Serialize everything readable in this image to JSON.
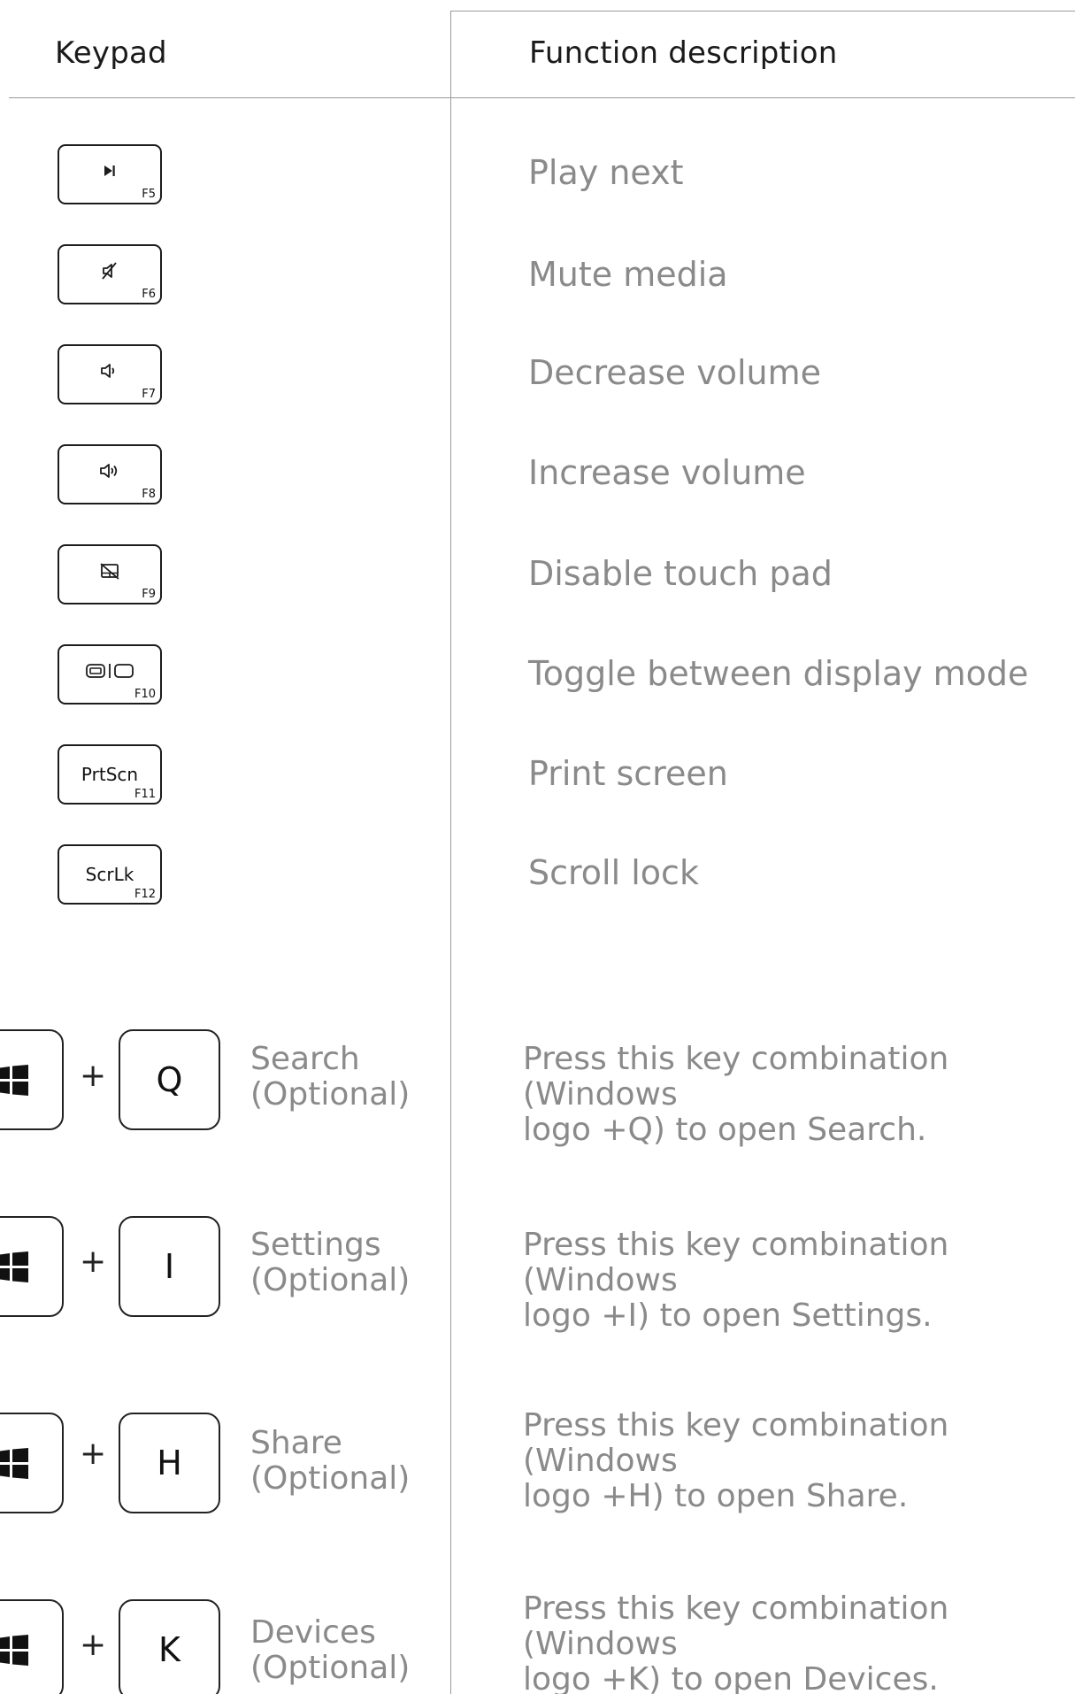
{
  "header": {
    "keypad": "Keypad",
    "function_description": "Function description"
  },
  "fkeys": [
    {
      "key": "F5",
      "icon": "play-next-icon",
      "description": "Play next"
    },
    {
      "key": "F6",
      "icon": "mute-icon",
      "description": "Mute media"
    },
    {
      "key": "F7",
      "icon": "volume-down-icon",
      "description": "Decrease volume"
    },
    {
      "key": "F8",
      "icon": "volume-up-icon",
      "description": "Increase volume"
    },
    {
      "key": "F9",
      "icon": "touchpad-disable-icon",
      "description": "Disable touch pad"
    },
    {
      "key": "F10",
      "icon": "display-mode-icon",
      "description": "Toggle between display mode"
    },
    {
      "key": "F11",
      "label": "PrtScn",
      "description": "Print screen"
    },
    {
      "key": "F12",
      "label": "ScrLk",
      "description": "Scroll lock"
    }
  ],
  "combos": [
    {
      "plus": "+",
      "key": "Q",
      "label_line1": "Search",
      "label_line2": "(Optional)",
      "desc_line1": "Press this key combination (Windows",
      "desc_line2": "logo +Q) to open Search."
    },
    {
      "plus": "+",
      "key": "I",
      "label_line1": "Settings",
      "label_line2": "(Optional)",
      "desc_line1": "Press this key combination (Windows",
      "desc_line2": "logo +I) to open Settings."
    },
    {
      "plus": "+",
      "key": "H",
      "label_line1": "Share",
      "label_line2": "(Optional)",
      "desc_line1": "Press this key combination (Windows",
      "desc_line2": "logo +H) to open Share."
    },
    {
      "plus": "+",
      "key": "K",
      "label_line1": "Devices",
      "label_line2": "(Optional)",
      "desc_line1": "Press this key combination (Windows",
      "desc_line2": "logo +K) to open Devices."
    }
  ],
  "icons": {
    "windows_logo": "windows-logo-icon"
  }
}
